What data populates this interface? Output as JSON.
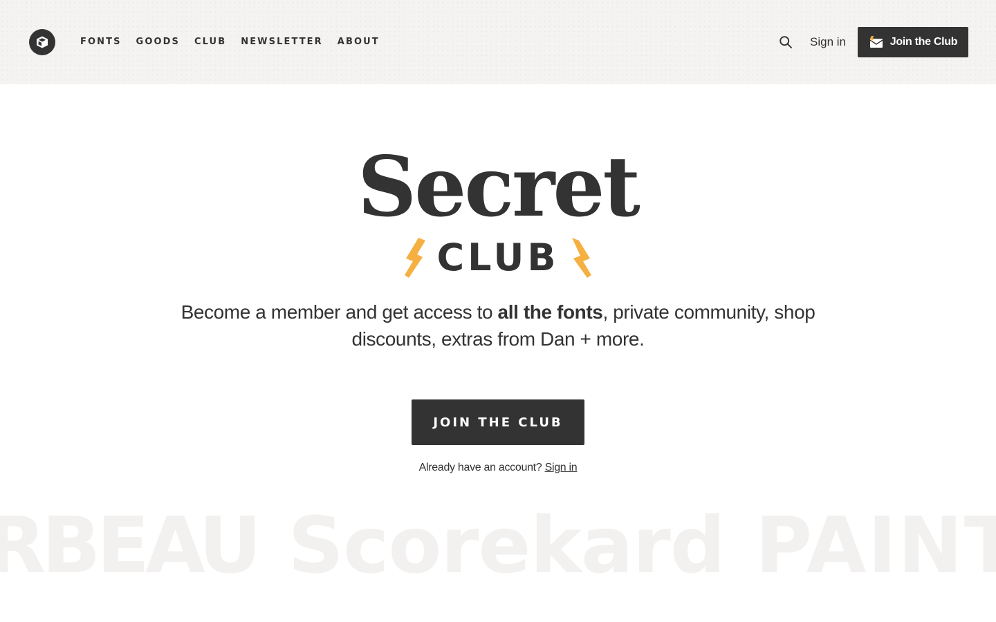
{
  "header": {
    "logo_icon": "cube-icon",
    "nav": [
      {
        "label": "FONTS"
      },
      {
        "label": "GOODS"
      },
      {
        "label": "CLUB"
      },
      {
        "label": "NEWSLETTER"
      },
      {
        "label": "ABOUT"
      }
    ],
    "search_icon": "search-icon",
    "signin_label": "Sign in",
    "join_label": "Join the Club",
    "join_icon": "envelope-bolt-icon"
  },
  "hero": {
    "logo_word": "Secret",
    "logo_sub": "CLUB",
    "bolt_color": "#f5b041",
    "tagline_before": "Become a member and get access to ",
    "tagline_bold": "all the fonts",
    "tagline_after": ", private community, shop discounts, extras from Dan + more.",
    "cta_label": "JOIN THE CLUB",
    "account_prompt": "Already have an account?",
    "account_link": "Sign in"
  },
  "marquee": {
    "words": [
      "RBEAU",
      "Scorekard",
      "PAINT FA"
    ]
  },
  "colors": {
    "ink": "#333333",
    "header_bg": "#f4f3f1",
    "accent": "#f5b041",
    "marquee_text": "#f2f1ef"
  }
}
